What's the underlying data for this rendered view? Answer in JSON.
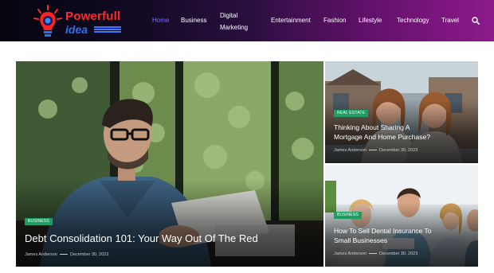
{
  "brand": {
    "line1": "Powerfull",
    "line2": "idea"
  },
  "nav": {
    "items": [
      {
        "label": "Home",
        "active": true
      },
      {
        "label": "Business"
      },
      {
        "label": "Digital",
        "label2": "Marketing"
      },
      {
        "label": "Entertainment"
      },
      {
        "label": "Fashion"
      },
      {
        "label": "Lifestyle"
      },
      {
        "label": "Technology"
      },
      {
        "label": "Travel"
      }
    ],
    "search_icon": "search-icon"
  },
  "articles": {
    "main": {
      "category": "BUSINESS",
      "title": "Debt Consolidation 101: Your Way Out Of The Red",
      "author": "James Anderson",
      "date": "December 30, 2023"
    },
    "side1": {
      "category": "REAL ESTATE",
      "title_line1": "Thinking About Sharing A",
      "title_line2": "Mortgage And Home Purchase?",
      "author": "James Anderson",
      "date": "December 30, 2023"
    },
    "side2": {
      "category": "BUSINESS",
      "title_line1": "How To Sell Dental Insurance To",
      "title_line2": "Small Businesses",
      "author": "James Anderson",
      "date": "December 30, 2023"
    }
  },
  "colors": {
    "badge": "#1f9d62",
    "nav_active": "#7b6fff",
    "brand_red": "#ff2a2a",
    "brand_blue": "#2f6ff2"
  }
}
